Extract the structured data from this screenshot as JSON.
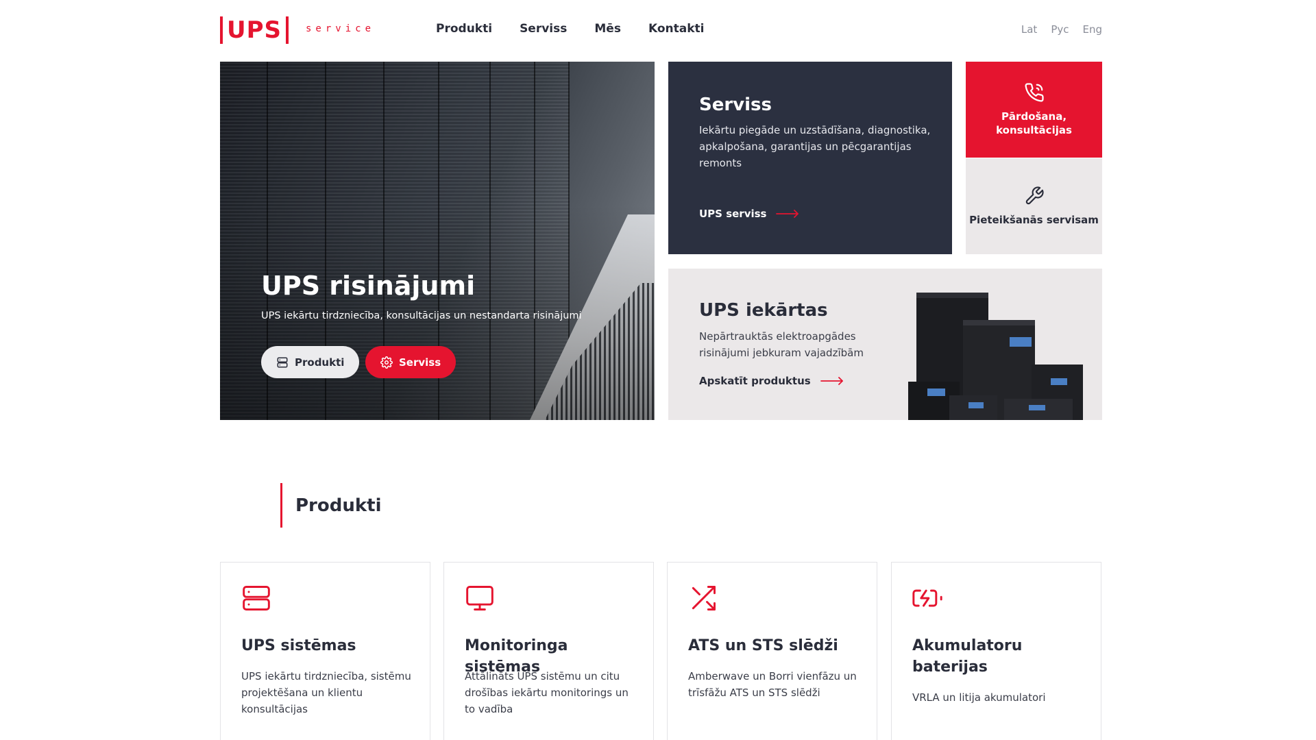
{
  "brand": {
    "logo_text": "UPS",
    "logo_sub": "service",
    "accent_color": "#e5142f",
    "dark_color": "#2b3040"
  },
  "nav": {
    "items": [
      {
        "label": "Produkti"
      },
      {
        "label": "Serviss"
      },
      {
        "label": "Mēs"
      },
      {
        "label": "Kontakti"
      }
    ]
  },
  "languages": [
    "Lat",
    "Рус",
    "Eng"
  ],
  "hero": {
    "title": "UPS risinājumi",
    "subtitle": "UPS iekārtu tirdzniecība, konsultācijas un nestandarta risinājumi",
    "btn_products": "Produkti",
    "btn_products_icon": "server-icon",
    "btn_service": "Serviss",
    "btn_service_icon": "gear-icon"
  },
  "service_card": {
    "title": "Serviss",
    "text": "Iekārtu piegāde un uzstādīšana, diagnostika, apkalpošana, garantijas un pēcgarantijas remonts",
    "link": "UPS serviss"
  },
  "tiles": {
    "sales": {
      "label": "Pārdošana, konsultācijas",
      "icon": "phone-icon"
    },
    "service_request": {
      "label": "Pieteikšanās servisam",
      "icon": "wrench-icon"
    }
  },
  "equipment_card": {
    "title": "UPS iekārtas",
    "text": "Nepārtrauktās elektroapgādes risinājumi jebkuram vajadzībām",
    "link": "Apskatīt produktus"
  },
  "products_section": {
    "title": "Produkti",
    "cards": [
      {
        "name": "UPS sistēmas",
        "desc": "UPS iekārtu tirdzniecība, sistēmu projektēšana un klientu konsultācijas",
        "icon": "server-icon"
      },
      {
        "name": "Monitoringa sistēmas",
        "desc": "Attālināts UPS sistēmu un citu drošības iekārtu monitorings un to vadība",
        "icon": "monitor-icon"
      },
      {
        "name": "ATS un STS slēdži",
        "desc": "Amberwave un Borri vienfāzu un trīsfāžu ATS un STS slēdži",
        "icon": "shuffle-icon"
      },
      {
        "name": "Akumulatoru baterijas",
        "desc": "VRLA un litija akumulatori",
        "icon": "battery-charging-icon"
      }
    ]
  }
}
